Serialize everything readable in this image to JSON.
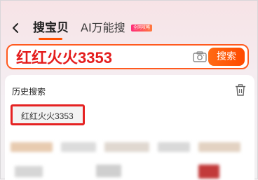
{
  "header": {
    "tab_primary": "搜宝贝",
    "tab_ai": "AI万能搜",
    "tab_ai_badge": "全网攻略"
  },
  "search": {
    "value": "红红火火3353",
    "button_label": "搜索"
  },
  "history": {
    "title": "历史搜索",
    "items": [
      "红红火火3353"
    ]
  },
  "colors": {
    "accent": "#ff5000",
    "highlight_border": "#e52222",
    "query_text": "#e41d1d"
  }
}
